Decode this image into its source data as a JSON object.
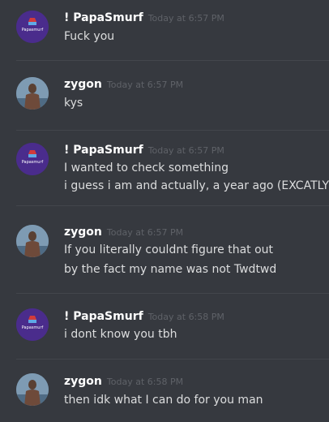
{
  "messages": [
    {
      "user": "! PapaSmurf",
      "time": "Today at 6:57 PM",
      "avatar": "papasmurf-avatar",
      "lines": [
        "Fuck you"
      ]
    },
    {
      "user": "zygon",
      "time": "Today at 6:57 PM",
      "avatar": "zygon-avatar",
      "lines": [
        "kys"
      ]
    },
    {
      "user": "! PapaSmurf",
      "time": "Today at 6:57 PM",
      "avatar": "papasmurf-avatar",
      "lines": [
        "I wanted to check something",
        "i guess i am and actually, a year ago (EXCATLY )"
      ]
    },
    {
      "user": "zygon",
      "time": "Today at 6:57 PM",
      "avatar": "zygon-avatar",
      "lines": [
        "If you literally couldnt figure that out",
        "by the fact my name was not Twdtwd"
      ]
    },
    {
      "user": "! PapaSmurf",
      "time": "Today at 6:58 PM",
      "avatar": "papasmurf-avatar",
      "lines": [
        "i dont know you tbh"
      ]
    },
    {
      "user": "zygon",
      "time": "Today at 6:58 PM",
      "avatar": "zygon-avatar",
      "lines": [
        "then idk what I can do for you man"
      ]
    }
  ],
  "avatar_text": {
    "papa": "Papasmurf"
  },
  "colors": {
    "background": "#36393f",
    "username": "#ffffff",
    "text": "#dcddde",
    "timestamp": "#5f6268",
    "papa_avatar": "#4a2c8c"
  }
}
